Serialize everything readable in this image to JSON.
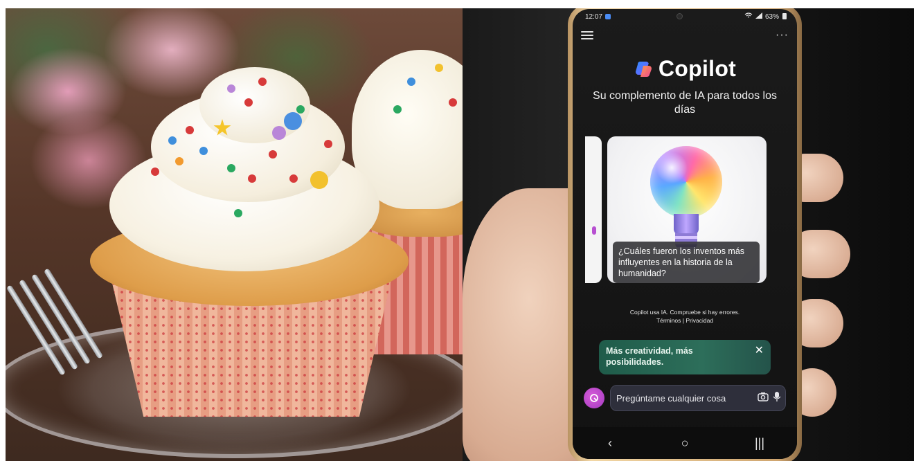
{
  "status_bar": {
    "time": "12:07",
    "signal_text": "63%"
  },
  "header": {
    "app_title": "Copilot",
    "tagline": "Su complemento de IA para todos los días"
  },
  "suggestion_card": {
    "text": "¿Cuáles fueron los inventos más influyentes en la historia de la humanidad?"
  },
  "disclaimer": {
    "text": "Copilot usa IA. Compruebe si hay errores.",
    "terms_link": "Términos",
    "separator": "|",
    "privacy_link": "Privacidad"
  },
  "promo_banner": {
    "text": "Más creatividad, más posibilidades.",
    "close_glyph": "✕"
  },
  "composer": {
    "placeholder": "Pregúntame cualquier cosa"
  },
  "nav_bar": {
    "back": "‹",
    "home": "○",
    "recents": "|||"
  },
  "colors": {
    "screen_bg": "#121212",
    "promo_bg": "#2d6e5a",
    "accent_purple": "#b74fd1",
    "input_bg": "#2e2f3b"
  },
  "icons": {
    "menu": "hamburger-icon",
    "more": "more-options-icon",
    "logo": "copilot-logo-icon",
    "close": "close-icon",
    "camera": "camera-icon",
    "mic": "microphone-icon",
    "avatar": "copilot-avatar-icon"
  }
}
